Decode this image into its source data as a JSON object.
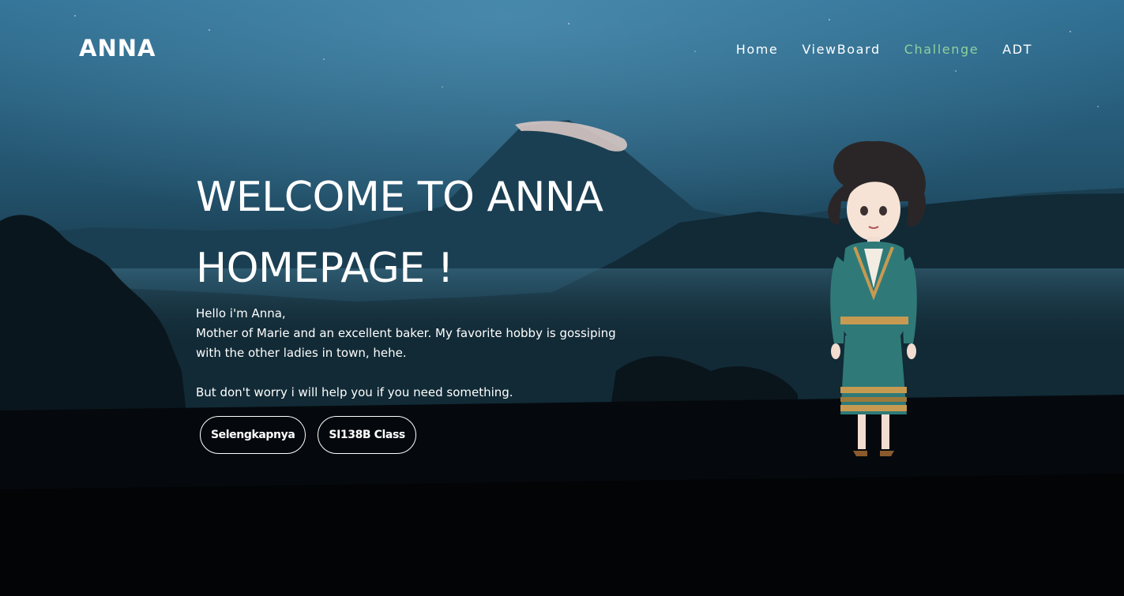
{
  "brand": {
    "name": "ANNA"
  },
  "nav": {
    "items": [
      {
        "label": "Home",
        "active": false
      },
      {
        "label": "ViewBoard",
        "active": false
      },
      {
        "label": "Challenge",
        "active": true
      },
      {
        "label": "ADT",
        "active": false
      }
    ],
    "active_color": "#8fd19e"
  },
  "hero": {
    "title_line1": "WELCOME TO ANNA",
    "title_line2": "HOMEPAGE !",
    "greeting": "Hello i'm Anna,",
    "bio_line1": "Mother of Marie and an excellent baker. My favorite hobby is gossiping",
    "bio_line2": "with the other ladies in town, hehe.",
    "help": "But don't worry i will help you if you need something."
  },
  "buttons": {
    "primary_label": "Selengkapnya",
    "secondary_label": "SI138B Class"
  },
  "colors": {
    "sky_top": "#2f6f93",
    "sky_mid": "#1f4a62",
    "ground": "#05080c"
  }
}
